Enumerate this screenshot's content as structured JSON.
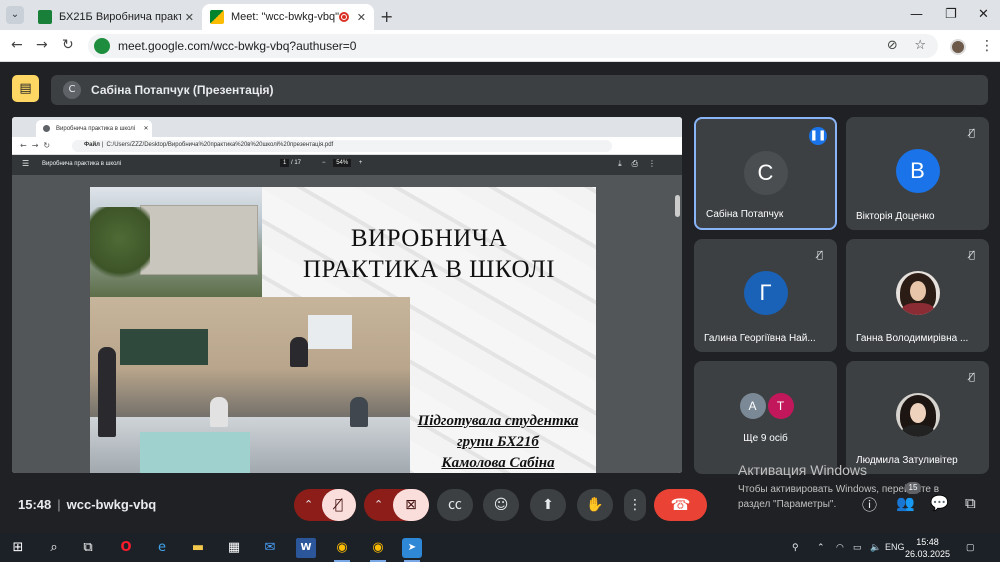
{
  "browser": {
    "tabs": [
      {
        "title": "БХ21Б Виробнича практика (п",
        "active": false
      },
      {
        "title": "Meet: \"wcc-bwkg-vbq\"",
        "active": true
      }
    ],
    "url": "meet.google.com/wcc-bwkg-vbq?authuser=0"
  },
  "meet": {
    "presenter_initial": "С",
    "presenter_label": "Сабіна Потапчук (Презентація)",
    "shared": {
      "tab_title": "Виробнича практика в школі",
      "address_prefix": "Файл",
      "address": "C:/Users/ZZZ/Desktop/Виробнича%20практика%20в%20школі%20презентація.pdf",
      "pdf_title": "Виробнича практика в школі",
      "page_current": "1",
      "page_total": "/ 17",
      "zoom": "54%",
      "slide_title_line1": "ВИРОБНИЧА",
      "slide_title_line2": "ПРАКТИКА В ШКОЛІ",
      "slide_sub_line1": "Підготувала студентка",
      "slide_sub_line2": "групи БХ21б",
      "slide_sub_line3": "Камолова Сабіна"
    },
    "participants": [
      {
        "initial": "С",
        "name": "Сабіна Потапчук",
        "color": "#4a4e51",
        "speaking": true
      },
      {
        "initial": "В",
        "name": "Вікторія Доценко",
        "color": "#1a73e8",
        "muted": true
      },
      {
        "initial": "Г",
        "name": "Галина Георгіївна Най...",
        "color": "#1a62b8",
        "muted": true
      },
      {
        "initial": "",
        "name": "Ганна Володимирівна ...",
        "photo": true,
        "muted": true
      },
      {
        "initials": [
          "А",
          "Т"
        ],
        "name": "Ще 9 осіб"
      },
      {
        "initial": "",
        "name": "Людмила Затуливітер",
        "photo": true,
        "muted": true
      }
    ],
    "time": "15:48",
    "meeting_code": "wcc-bwkg-vbq",
    "people_count": "15",
    "activation_title": "Активация Windows",
    "activation_text1": "Чтобы активировать Windows, перейдите в",
    "activation_text2": "раздел \"Параметры\"."
  },
  "taskbar": {
    "lang": "ENG",
    "time": "15:48",
    "date": "26.03.2025"
  }
}
